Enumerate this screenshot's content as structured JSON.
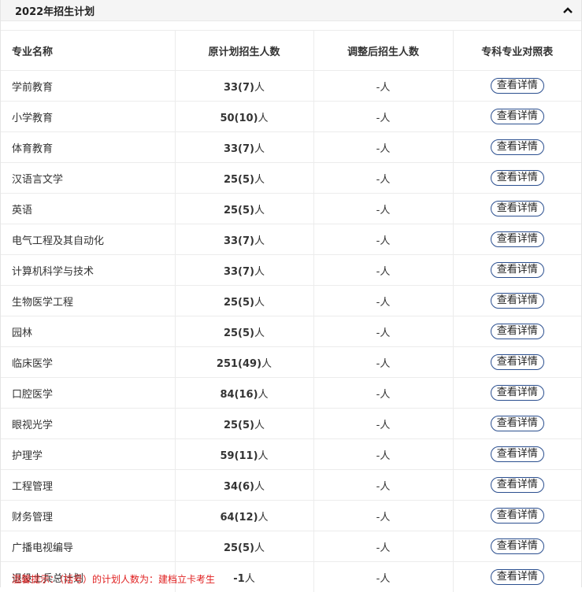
{
  "header": {
    "title": "2022年招生计划"
  },
  "table": {
    "headers": [
      "专业名称",
      "原计划招生人数",
      "调整后招生人数",
      "专科专业对照表"
    ],
    "unit": "人",
    "button_label": "查看详情",
    "rows": [
      {
        "name": "学前教育",
        "plan": "33(7)",
        "adjusted": "-"
      },
      {
        "name": "小学教育",
        "plan": "50(10)",
        "adjusted": "-"
      },
      {
        "name": "体育教育",
        "plan": "33(7)",
        "adjusted": "-"
      },
      {
        "name": "汉语言文学",
        "plan": "25(5)",
        "adjusted": "-"
      },
      {
        "name": "英语",
        "plan": "25(5)",
        "adjusted": "-"
      },
      {
        "name": "电气工程及其自动化",
        "plan": "33(7)",
        "adjusted": "-"
      },
      {
        "name": "计算机科学与技术",
        "plan": "33(7)",
        "adjusted": "-"
      },
      {
        "name": "生物医学工程",
        "plan": "25(5)",
        "adjusted": "-"
      },
      {
        "name": "园林",
        "plan": "25(5)",
        "adjusted": "-"
      },
      {
        "name": "临床医学",
        "plan": "251(49)",
        "adjusted": "-"
      },
      {
        "name": "口腔医学",
        "plan": "84(16)",
        "adjusted": "-"
      },
      {
        "name": "眼视光学",
        "plan": "25(5)",
        "adjusted": "-"
      },
      {
        "name": "护理学",
        "plan": "59(11)",
        "adjusted": "-"
      },
      {
        "name": "工程管理",
        "plan": "34(6)",
        "adjusted": "-"
      },
      {
        "name": "财务管理",
        "plan": "64(12)",
        "adjusted": "-"
      },
      {
        "name": "广播电视编导",
        "plan": "25(5)",
        "adjusted": "-"
      },
      {
        "name": "退役士兵总计划",
        "plan": "-1",
        "adjusted": "-"
      }
    ]
  },
  "tip": "温馨提示：（括号）的计划人数为：建档立卡考生"
}
